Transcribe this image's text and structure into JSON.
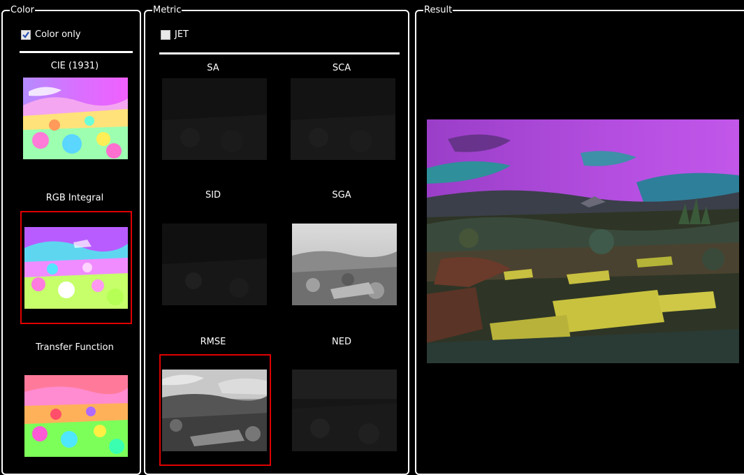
{
  "color_panel": {
    "title": "Color",
    "color_only": {
      "label": "Color only",
      "checked": true
    },
    "items": [
      {
        "label": "CIE (1931)",
        "selected": false
      },
      {
        "label": "RGB Integral",
        "selected": true
      },
      {
        "label": "Transfer Function",
        "selected": false
      }
    ]
  },
  "metric_panel": {
    "title": "Metric",
    "jet": {
      "label": "JET",
      "checked": false
    },
    "items": [
      {
        "label": "SA",
        "selected": false
      },
      {
        "label": "SCA",
        "selected": false
      },
      {
        "label": "SID",
        "selected": false
      },
      {
        "label": "SGA",
        "selected": false
      },
      {
        "label": "RMSE",
        "selected": true
      },
      {
        "label": "NED",
        "selected": false
      }
    ]
  },
  "result_panel": {
    "title": "Result"
  },
  "colors": {
    "selection": "#e00000",
    "background": "#000000",
    "frame": "#ffffff"
  }
}
